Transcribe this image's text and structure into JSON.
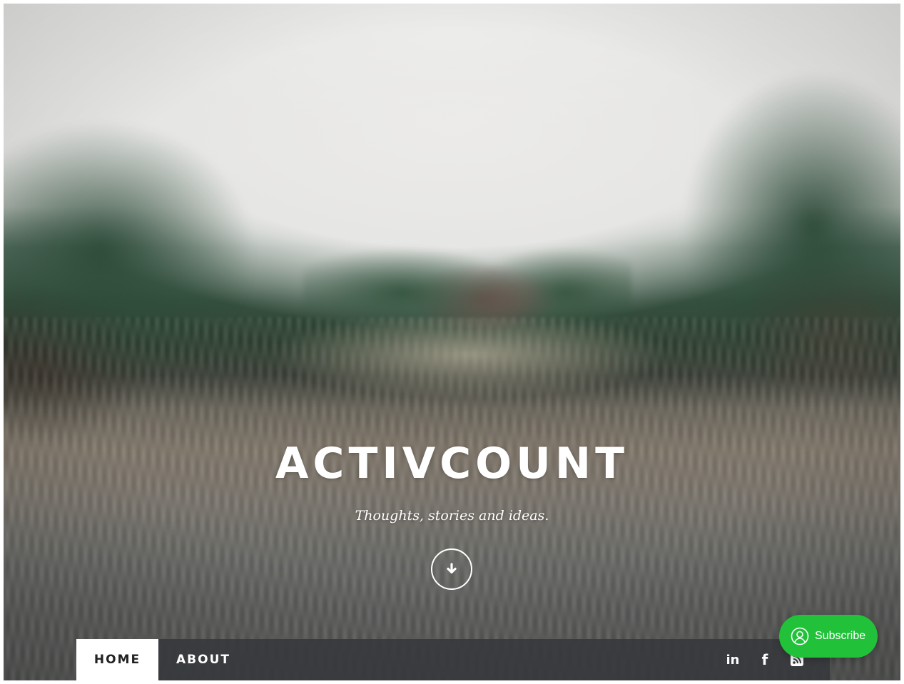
{
  "site": {
    "title": "ACTIVCOUNT",
    "description": "Thoughts, stories and ideas."
  },
  "hero": {
    "scroll_icon": "arrow-down-icon"
  },
  "nav": {
    "items": [
      {
        "label": "HOME",
        "active": true
      },
      {
        "label": "ABOUT",
        "active": false
      }
    ],
    "social": {
      "linkedin_label": "in",
      "facebook_label": "f",
      "rss_icon": "rss-icon"
    }
  },
  "subscribe": {
    "label": "Subscribe",
    "icon": "user-circle-icon",
    "color": "#21c23a"
  },
  "colors": {
    "nav_background": "#36383c",
    "active_tab_background": "#ffffff",
    "text_light": "#ffffff",
    "text_dark": "#222222"
  }
}
